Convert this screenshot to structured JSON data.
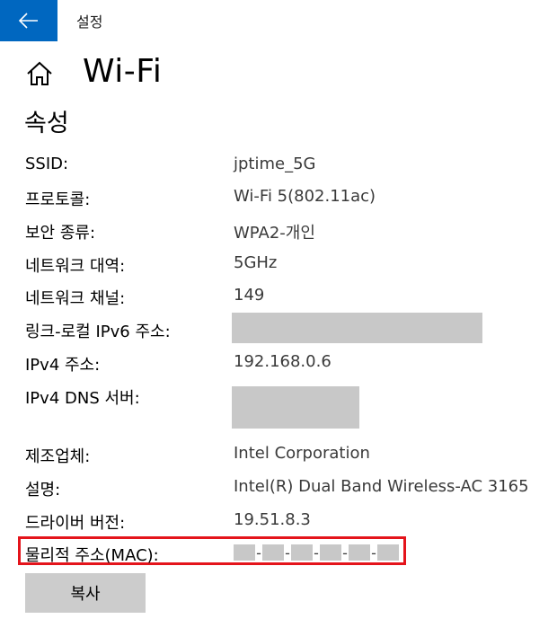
{
  "window": {
    "title": "설정",
    "back_icon": "arrow-left-icon",
    "accent_color": "#0067c0"
  },
  "header": {
    "home_icon": "home-icon",
    "page_title": "Wi-Fi"
  },
  "section": {
    "title": "속성"
  },
  "properties": [
    {
      "label": "SSID:",
      "value": "jptime_5G"
    },
    {
      "label": "프로토콜:",
      "value": "Wi-Fi 5(802.11ac)"
    },
    {
      "label": "보안 종류:",
      "value": "WPA2-개인"
    },
    {
      "label": "네트워크 대역:",
      "value": "5GHz"
    },
    {
      "label": "네트워크 채널:",
      "value": "149"
    },
    {
      "label": "링크-로컬 IPv6 주소:",
      "value": ""
    },
    {
      "label": "IPv4 주소:",
      "value": "192.168.0.6"
    },
    {
      "label": "IPv4 DNS 서버:",
      "value": ""
    },
    {
      "label": "제조업체:",
      "value": "Intel Corporation"
    },
    {
      "label": "설명:",
      "value": "Intel(R) Dual Band Wireless-AC 3165"
    },
    {
      "label": "드라이버 버전:",
      "value": "19.51.8.3"
    },
    {
      "label": "물리적 주소(MAC):",
      "value": ""
    }
  ],
  "mac": {
    "separator": "-",
    "highlight_color": "#e4141b"
  },
  "actions": {
    "copy_label": "복사"
  }
}
